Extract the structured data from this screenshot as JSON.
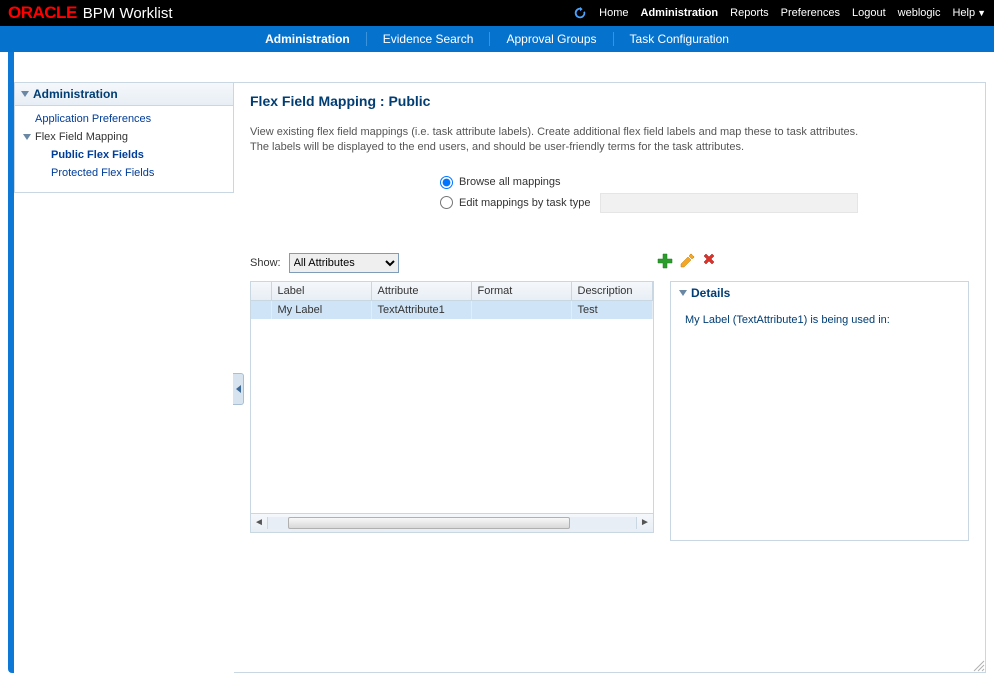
{
  "brand": {
    "logo": "ORACLE",
    "product": "BPM Worklist"
  },
  "topnav": {
    "home": "Home",
    "administration": "Administration",
    "reports": "Reports",
    "preferences": "Preferences",
    "logout": "Logout",
    "user": "weblogic",
    "help": "Help"
  },
  "bluenav": {
    "administration": "Administration",
    "evidence_search": "Evidence Search",
    "approval_groups": "Approval Groups",
    "task_configuration": "Task Configuration"
  },
  "sidebar": {
    "title": "Administration",
    "items": {
      "app_prefs": "Application Preferences",
      "flex_mapping": "Flex Field Mapping",
      "public_flex": "Public Flex Fields",
      "protected_flex": "Protected Flex Fields"
    }
  },
  "page": {
    "title": "Flex Field Mapping : Public",
    "desc1": "View existing flex field mappings (i.e. task attribute labels). Create additional flex field labels and map these to task attributes.",
    "desc2": "The labels will be displayed to the end users, and should be user-friendly terms for the task attributes.",
    "radio_browse": "Browse all mappings",
    "radio_edit": "Edit mappings by task type",
    "show_label": "Show:",
    "show_value": "All Attributes",
    "table": {
      "headers": {
        "label": "Label",
        "attribute": "Attribute",
        "format": "Format",
        "description": "Description"
      },
      "row": {
        "label": "My Label",
        "attribute": "TextAttribute1",
        "format": "",
        "description": "Test"
      }
    },
    "details": {
      "title": "Details",
      "text": "My Label (TextAttribute1) is being used in:"
    }
  }
}
